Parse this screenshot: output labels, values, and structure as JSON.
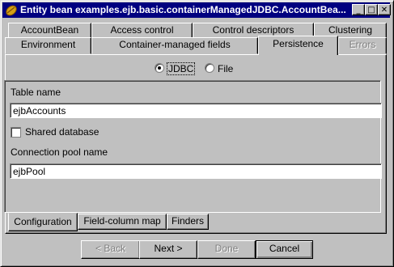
{
  "window": {
    "title": "Entity bean examples.ejb.basic.containerManagedJDBC.AccountBea..."
  },
  "title_buttons": {
    "minimize": "_",
    "maximize": "□",
    "close": "✕"
  },
  "tabs_row1": [
    "AccountBean",
    "Access control",
    "Control descriptors",
    "Clustering"
  ],
  "tabs_row2": [
    "Environment",
    "Container-managed fields",
    "Persistence",
    "Errors"
  ],
  "persistence": {
    "mode_options": [
      "JDBC",
      "File"
    ],
    "selected_mode": "JDBC",
    "table_name_label": "Table name",
    "table_name_value": "ejbAccounts",
    "shared_database_label": "Shared database",
    "shared_database_checked": false,
    "connection_pool_label": "Connection pool name",
    "connection_pool_value": "ejbPool"
  },
  "bottom_tabs": [
    "Configuration",
    "Field-column map",
    "Finders"
  ],
  "active_bottom_tab": "Configuration",
  "buttons": {
    "back": "< Back",
    "next": "Next >",
    "done": "Done",
    "cancel": "Cancel"
  },
  "colors": {
    "titlebar": "#000080",
    "face": "#c0c0c0"
  }
}
